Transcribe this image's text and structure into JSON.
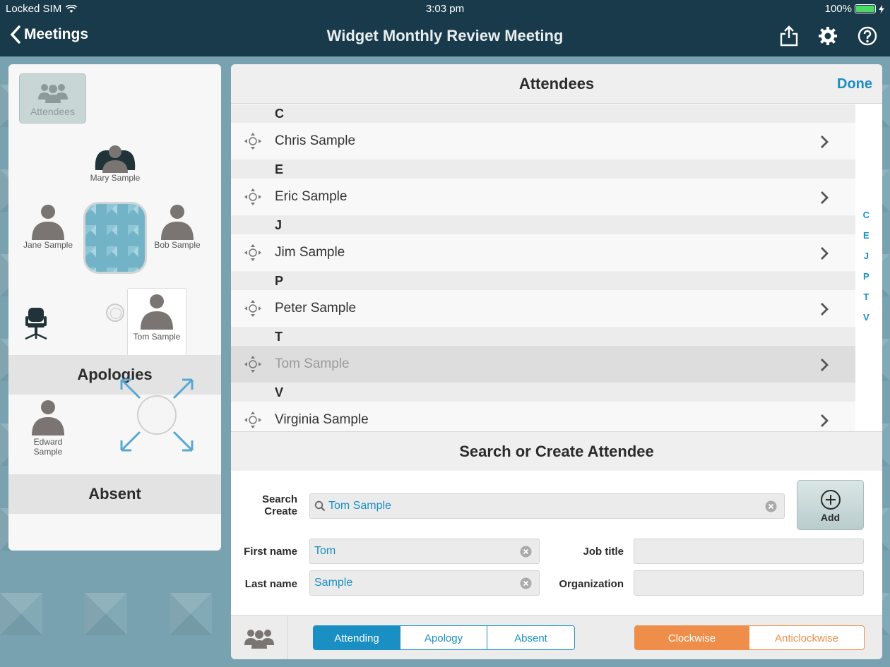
{
  "status": {
    "carrier": "Locked SIM",
    "time": "3:03 pm",
    "battery": "100%"
  },
  "nav": {
    "back_label": "Meetings",
    "title": "Widget Monthly Review Meeting"
  },
  "left": {
    "attendees_button": "Attendees",
    "seats": {
      "top": "Mary Sample",
      "left": "Jane Sample",
      "right": "Bob Sample",
      "dragging": "Tom Sample"
    },
    "apologies_header": "Apologies",
    "apologies": [
      "Edward Sample"
    ],
    "absent_header": "Absent"
  },
  "attendees": {
    "header": "Attendees",
    "done": "Done",
    "groups": [
      {
        "letter": "C",
        "names": [
          "Chris Sample"
        ]
      },
      {
        "letter": "E",
        "names": [
          "Eric Sample"
        ]
      },
      {
        "letter": "J",
        "names": [
          "Jim Sample"
        ]
      },
      {
        "letter": "P",
        "names": [
          "Peter Sample"
        ]
      },
      {
        "letter": "T",
        "names": [
          "Tom Sample"
        ]
      },
      {
        "letter": "V",
        "names": [
          "Virginia Sample"
        ]
      }
    ],
    "index": [
      "C",
      "E",
      "J",
      "P",
      "T",
      "V"
    ]
  },
  "search": {
    "header": "Search or Create Attendee",
    "search_label_1": "Search",
    "search_label_2": "Create",
    "search_value": "Tom Sample",
    "first_name_label": "First name",
    "first_name": "Tom",
    "last_name_label": "Last name",
    "last_name": "Sample",
    "job_title_label": "Job title",
    "job_title": "",
    "organization_label": "Organization",
    "organization": "",
    "add_label": "Add"
  },
  "bottom": {
    "status_options": [
      "Attending",
      "Apology",
      "Absent"
    ],
    "direction_options": [
      "Clockwise",
      "Anticlockwise"
    ]
  },
  "colors": {
    "accent": "#1a8fc4",
    "orange": "#ee8e4a",
    "navbar": "#183a4a"
  }
}
